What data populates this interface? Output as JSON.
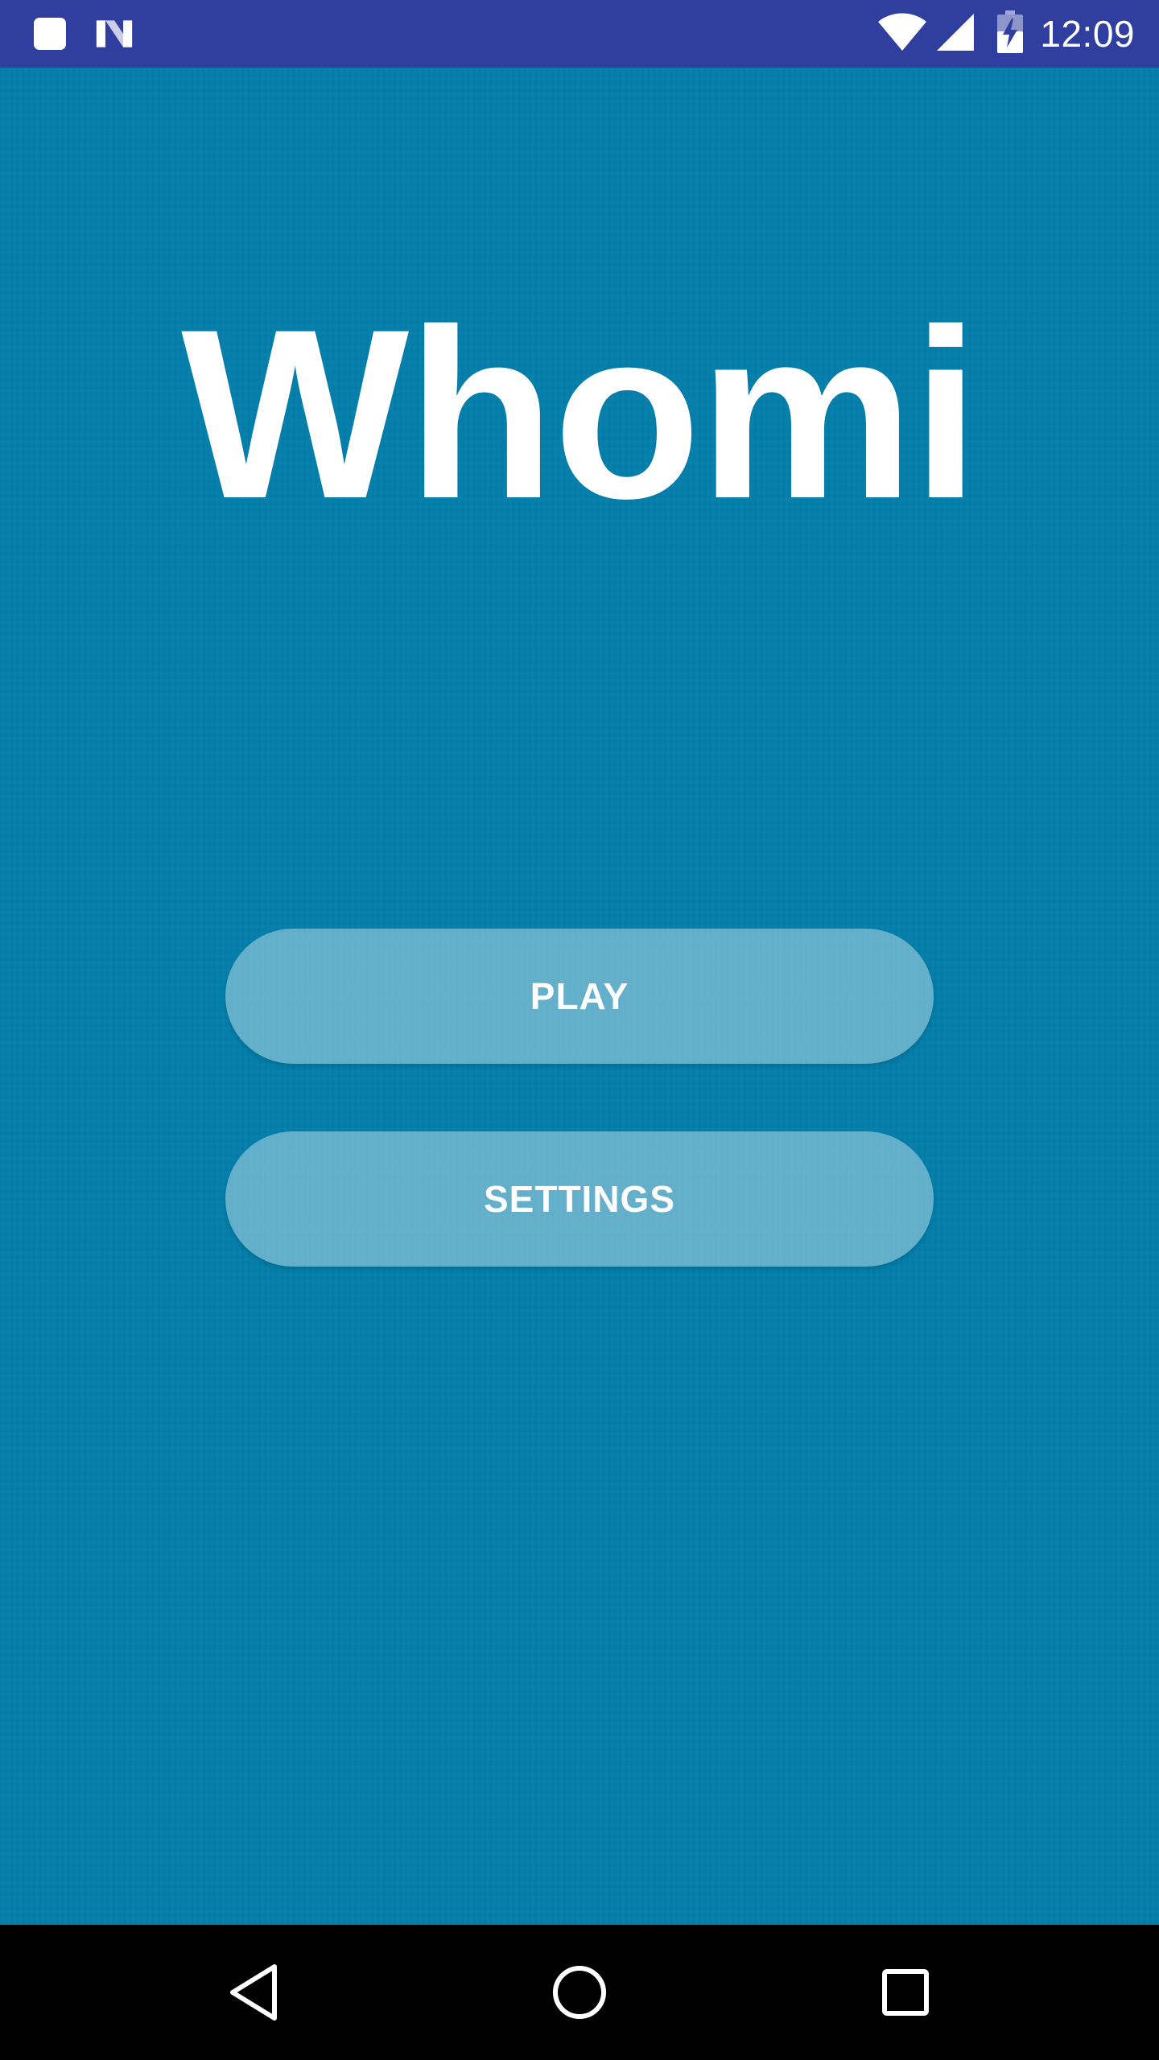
{
  "status_bar": {
    "time": "12:09",
    "icons": [
      "notification-square-icon",
      "n-logo-icon",
      "wifi-icon",
      "cell-signal-icon",
      "battery-charging-icon"
    ]
  },
  "app": {
    "title": "Whomi",
    "background_color": "#047fab",
    "buttons": {
      "play_label": "PLAY",
      "settings_label": "SETTINGS"
    }
  },
  "nav_bar": {
    "icons": [
      "back-icon",
      "home-icon",
      "recents-icon"
    ]
  },
  "colors": {
    "status_bar": "#303f9f",
    "nav_bar": "#000000",
    "text": "#ffffff"
  }
}
